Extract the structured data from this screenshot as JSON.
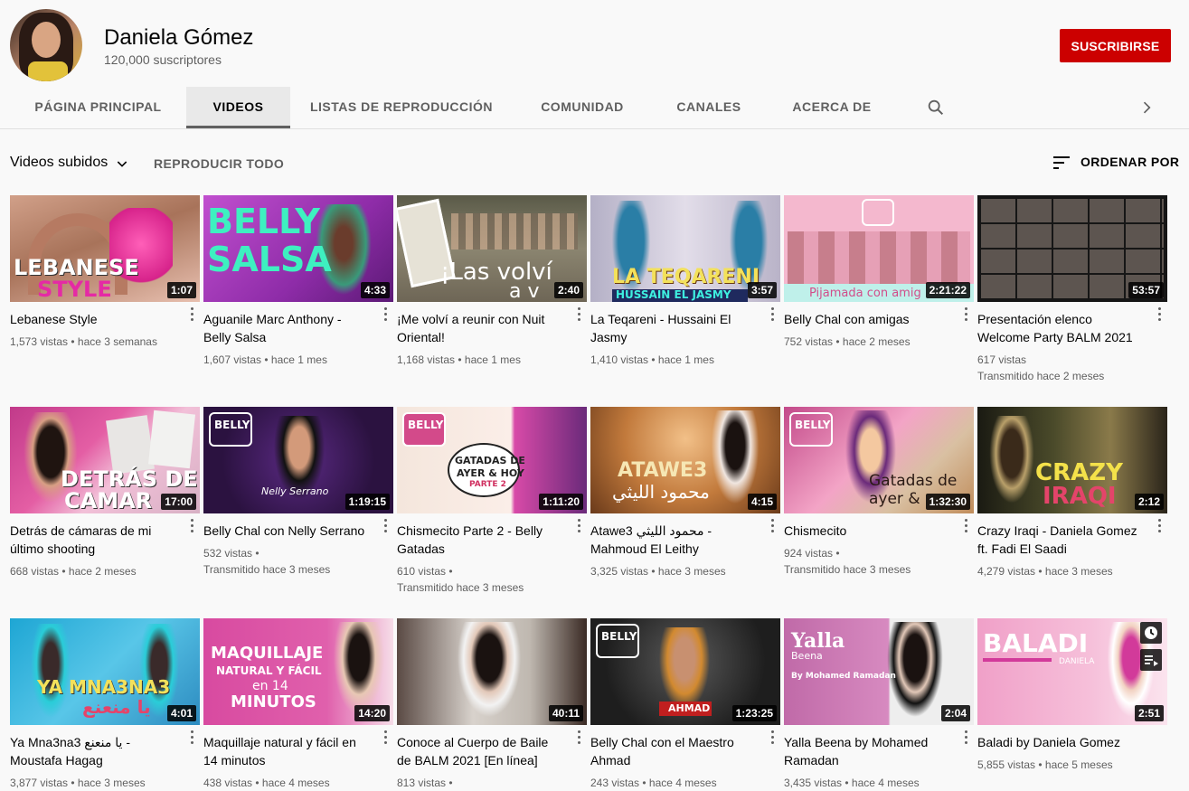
{
  "channel": {
    "name": "Daniela Gómez",
    "subscribers": "120,000 suscriptores",
    "subscribe_label": "SUSCRIBIRSE"
  },
  "tabs": [
    {
      "label": "PÁGINA PRINCIPAL"
    },
    {
      "label": "VIDEOS"
    },
    {
      "label": "LISTAS DE REPRODUCCIÓN"
    },
    {
      "label": "COMUNIDAD"
    },
    {
      "label": "CANALES"
    },
    {
      "label": "ACERCA DE"
    }
  ],
  "toolbar": {
    "filter_label": "Videos subidos",
    "play_all": "REPRODUCIR TODO",
    "sort_label": "ORDENAR POR"
  },
  "icons": [
    "search-icon",
    "chevron-right-icon",
    "chevron-down-icon",
    "sort-icon",
    "more-vert-icon",
    "watch-later-icon",
    "add-to-queue-icon"
  ],
  "colors": {
    "subscribe": "#cc0000",
    "text": "#030303",
    "secondary": "#606060"
  },
  "videos": [
    {
      "title": "Lebanese Style",
      "duration": "1:07",
      "meta1": "1,573 vistas • hace 3 semanas",
      "meta2": "",
      "thumb_text": "LEBANESE STYLE"
    },
    {
      "title": "Aguanile Marc Anthony - Belly Salsa",
      "duration": "4:33",
      "meta1": "1,607 vistas • hace 1 mes",
      "meta2": "",
      "thumb_text": "BELLY SALSA"
    },
    {
      "title": "¡Me volví a reunir con Nuit Oriental!",
      "duration": "2:40",
      "meta1": "1,168 vistas • hace 1 mes",
      "meta2": "",
      "thumb_text": "¡Las volví a v"
    },
    {
      "title": "La Teqareni - Hussaini El Jasmy",
      "duration": "3:57",
      "meta1": "1,410 vistas • hace 1 mes",
      "meta2": "",
      "thumb_text": "LA TEQARENI HUSSAIN EL JASMY"
    },
    {
      "title": "Belly Chal con amigas",
      "duration": "2:21:22",
      "meta1": "752 vistas • hace 2 meses",
      "meta2": "",
      "thumb_text": "Pijamada con amig"
    },
    {
      "title": "Presentación elenco Welcome Party BALM 2021",
      "duration": "53:57",
      "meta1": "617 vistas",
      "meta2": "Transmitido hace 2 meses",
      "thumb_text": ""
    },
    {
      "title": "Detrás de cámaras de mi último shooting",
      "duration": "17:00",
      "meta1": "668 vistas • hace 2 meses",
      "meta2": "",
      "thumb_text": "DETRÁS DE CAMAR"
    },
    {
      "title": "Belly Chal con Nelly Serrano",
      "duration": "1:19:15",
      "meta1": "532 vistas •",
      "meta2": "Transmitido hace 3 meses",
      "thumb_text": "BELLY Nelly Serrano"
    },
    {
      "title": "Chismecito Parte 2 - Belly Gatadas",
      "duration": "1:11:20",
      "meta1": "610 vistas •",
      "meta2": "Transmitido hace 3 meses",
      "thumb_text": "GATADAS DE AYER & HOY PARTE 2"
    },
    {
      "title": "Atawe3 محمود الليثي - Mahmoud El Leithy",
      "duration": "4:15",
      "meta1": "3,325 vistas • hace 3 meses",
      "meta2": "",
      "thumb_text": "ATAWE3 محمود الليثي"
    },
    {
      "title": "Chismecito",
      "duration": "1:32:30",
      "meta1": "924 vistas •",
      "meta2": "Transmitido hace 3 meses",
      "thumb_text": "Gatadas de ayer &"
    },
    {
      "title": "Crazy Iraqi - Daniela Gomez ft. Fadi El Saadi",
      "duration": "2:12",
      "meta1": "4,279 vistas • hace 3 meses",
      "meta2": "",
      "thumb_text": "CRAZY IRAQI"
    },
    {
      "title": "Ya Mna3na3 يا منعنع - Moustafa Hagag",
      "duration": "4:01",
      "meta1": "3,877 vistas • hace 3 meses",
      "meta2": "",
      "thumb_text": "YA MNA3NA3 يا منعنع"
    },
    {
      "title": "Maquillaje natural y fácil en 14 minutos",
      "duration": "14:20",
      "meta1": "438 vistas • hace 4 meses",
      "meta2": "",
      "thumb_text": "MAQUILLAJE NATURAL Y FÁCIL en 14 MINUTOS"
    },
    {
      "title": "Conoce al Cuerpo de Baile de BALM 2021 [En línea]",
      "duration": "40:11",
      "meta1": "813 vistas •",
      "meta2": "",
      "thumb_text": ""
    },
    {
      "title": "Belly Chal con el Maestro Ahmad",
      "duration": "1:23:25",
      "meta1": "243 vistas • hace 4 meses",
      "meta2": "",
      "thumb_text": "AHMAD"
    },
    {
      "title": "Yalla Beena by Mohamed Ramadan",
      "duration": "2:04",
      "meta1": "3,435 vistas • hace 4 meses",
      "meta2": "",
      "thumb_text": "Yalla Beena By Mohamed Ramadan"
    },
    {
      "title": "Baladi by Daniela Gomez",
      "duration": "2:51",
      "meta1": "5,855 vistas • hace 5 meses",
      "meta2": "",
      "thumb_text": "BALADI DANIELA"
    }
  ]
}
